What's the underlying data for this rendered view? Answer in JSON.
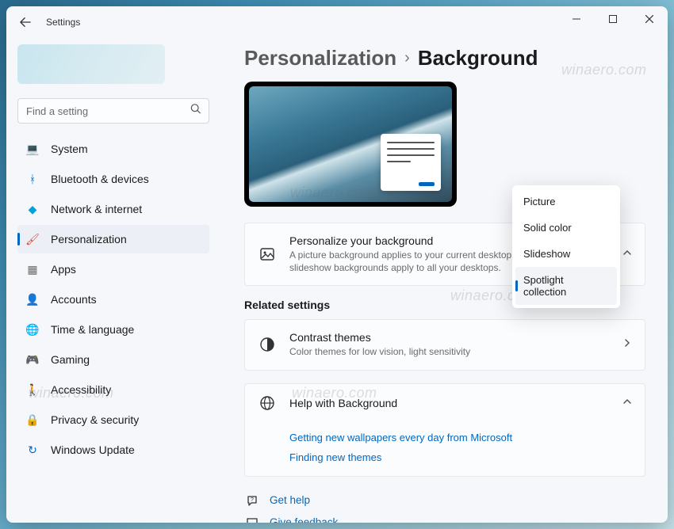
{
  "app_title": "Settings",
  "search": {
    "placeholder": "Find a setting"
  },
  "nav": [
    {
      "icon": "💻",
      "label": "System",
      "color": "#0067c0"
    },
    {
      "icon": "ᚼ",
      "label": "Bluetooth & devices",
      "color": "#0067c0"
    },
    {
      "icon": "◆",
      "label": "Network & internet",
      "color": "#00a2d8"
    },
    {
      "icon": "🖌",
      "label": "Personalization",
      "color": "#d44a2e",
      "active": true
    },
    {
      "icon": "▦",
      "label": "Apps",
      "color": "#6b6b6b"
    },
    {
      "icon": "👤",
      "label": "Accounts",
      "color": "#d68a2e"
    },
    {
      "icon": "🌐",
      "label": "Time & language",
      "color": "#6b6b6b"
    },
    {
      "icon": "🎮",
      "label": "Gaming",
      "color": "#6b6b6b"
    },
    {
      "icon": "🚶",
      "label": "Accessibility",
      "color": "#1488c8"
    },
    {
      "icon": "🔒",
      "label": "Privacy & security",
      "color": "#6b6b6b"
    },
    {
      "icon": "↻",
      "label": "Windows Update",
      "color": "#0067c0"
    }
  ],
  "breadcrumb": {
    "parent": "Personalization",
    "current": "Background"
  },
  "personalize_card": {
    "title": "Personalize your background",
    "desc": "A picture background applies to your current desktop. Solid color or slideshow backgrounds apply to all your desktops."
  },
  "dropdown": {
    "options": [
      "Picture",
      "Solid color",
      "Slideshow",
      "Spotlight collection"
    ],
    "selected": "Spotlight collection"
  },
  "related_title": "Related settings",
  "contrast_card": {
    "title": "Contrast themes",
    "desc": "Color themes for low vision, light sensitivity"
  },
  "help_card": {
    "title": "Help with Background"
  },
  "help_links": [
    "Getting new wallpapers every day from Microsoft",
    "Finding new themes"
  ],
  "footer": {
    "get_help": "Get help",
    "feedback": "Give feedback"
  },
  "watermark": "winaero.com"
}
